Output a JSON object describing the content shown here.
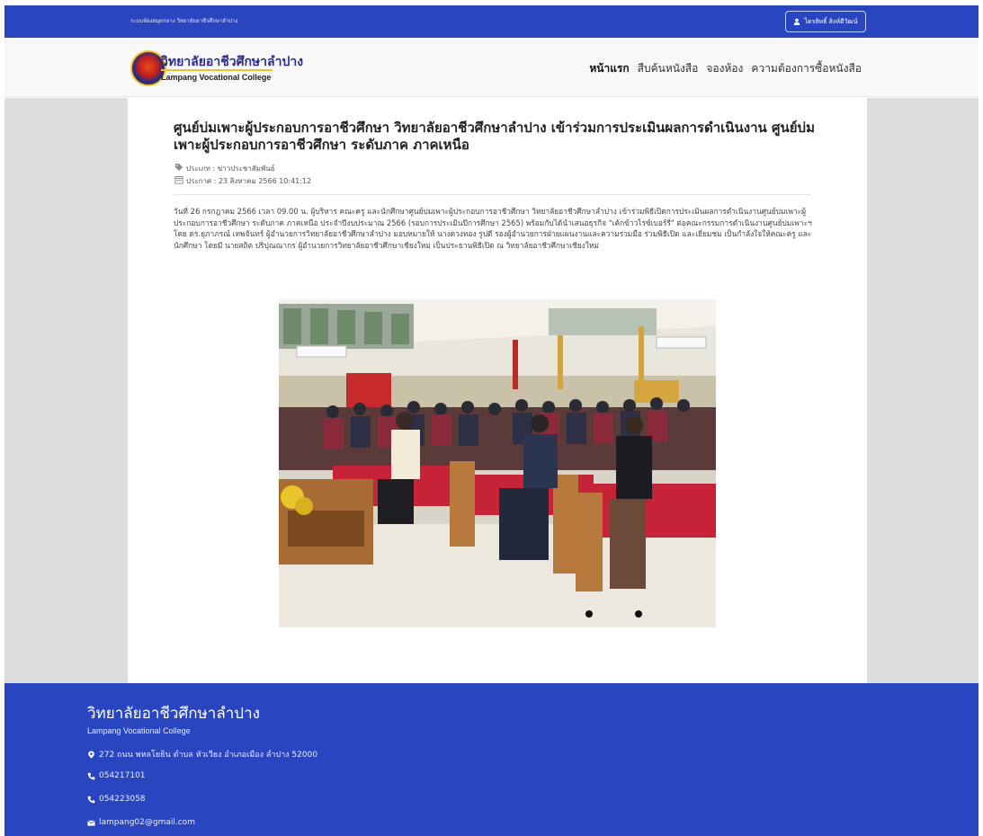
{
  "topbar": {
    "system_title": "ระบบห้องสมุดกลาง วิทยาลัยอาชีวศึกษาลำปาง",
    "user_name": "ไตรสิทธิ์ สิงห์ตีวัฒน์"
  },
  "header": {
    "brand_th": "วิทยาลัยอาชีวศึกษาลำปาง",
    "brand_en": "Lampang Vocational College",
    "nav": [
      "หน้าแรก",
      "สืบค้นหนังสือ",
      "จองห้อง",
      "ความต้องการซื้อหนังสือ"
    ]
  },
  "article": {
    "title": "ศูนย์บ่มเพาะผู้ประกอบการอาชีวศึกษา วิทยาลัยอาชีวศึกษาลำปาง เข้าร่วมการประเมินผลการดำเนินงาน ศูนย์บ่มเพาะผู้ประกอบการอาชีวศึกษา ระดับภาค ภาคเหนือ",
    "category": "ประเภท : ข่าวประชาสัมพันธ์",
    "posted": "ประกาศ : 23 สิงหาคม 2566 10:41:12",
    "body": "วันที่ 26 กรกฎาคม 2566 เวลา 09.00 น. ผู้บริหาร คณะครู และนักศึกษาศูนย์บ่มเพาะผู้ประกอบการอาชีวศึกษา วิทยาลัยอาชีวศึกษาลำปาง เข้าร่วมพิธีเปิดการประเมินผลการดำเนินงานศูนย์บ่มเพาะผู้ประกอบการอาชีวศึกษา ระดับภาค ภาคเหนือ ประจำปีงบประมาณ 2566 (รอบการประเมินปีการศึกษา 2565) พร้อมกับได้นำเสนอธุรกิจ \"เค้กข้าวไรซ์เบอร์รี่\" ต่อคณะกรรมการดำเนินงานศูนย์บ่มเพาะฯ โดย ดร.ยุภาภรณ์ เทพจันทร์ ผู้อำนวยการวิทยาลัยอาชีวศึกษาลำปาง มอบหมายให้ นางดวงทอง รูปดี รองผู้อำนวยการฝ่ายแผนงานและความร่วมมือ ร่วมพิธีเปิด และเยี่ยมชม เป็นกำลังใจให้คณะครู และนักศึกษา โดยมี นายสถิต ปริปุณณากร ผู้อำนวยการวิทยาลัยอาชีวศึกษาเชียงใหม่ เป็นประธานพิธีเปิด ณ วิทยาลัยอาชีวศึกษาเชียงใหม่"
  },
  "footer": {
    "title": "วิทยาลัยอาชีวศึกษาลำปาง",
    "subtitle": "Lampang Vocational College",
    "address": "272 ถนน พหลโยธิน ตำบล หัวเวียง อำเภอเมือง ลำปาง 52000",
    "phone1": "054217101",
    "phone2": "054223058",
    "email": "lampang02@gmail.com"
  },
  "icons": [
    "user-icon",
    "tag-icon",
    "calendar-icon",
    "map-marker-icon",
    "phone-icon",
    "envelope-icon"
  ],
  "colors": {
    "primary": "#2a45c0",
    "page_bg": "#dcdcdc",
    "brand_gold": "#f2c12a"
  }
}
